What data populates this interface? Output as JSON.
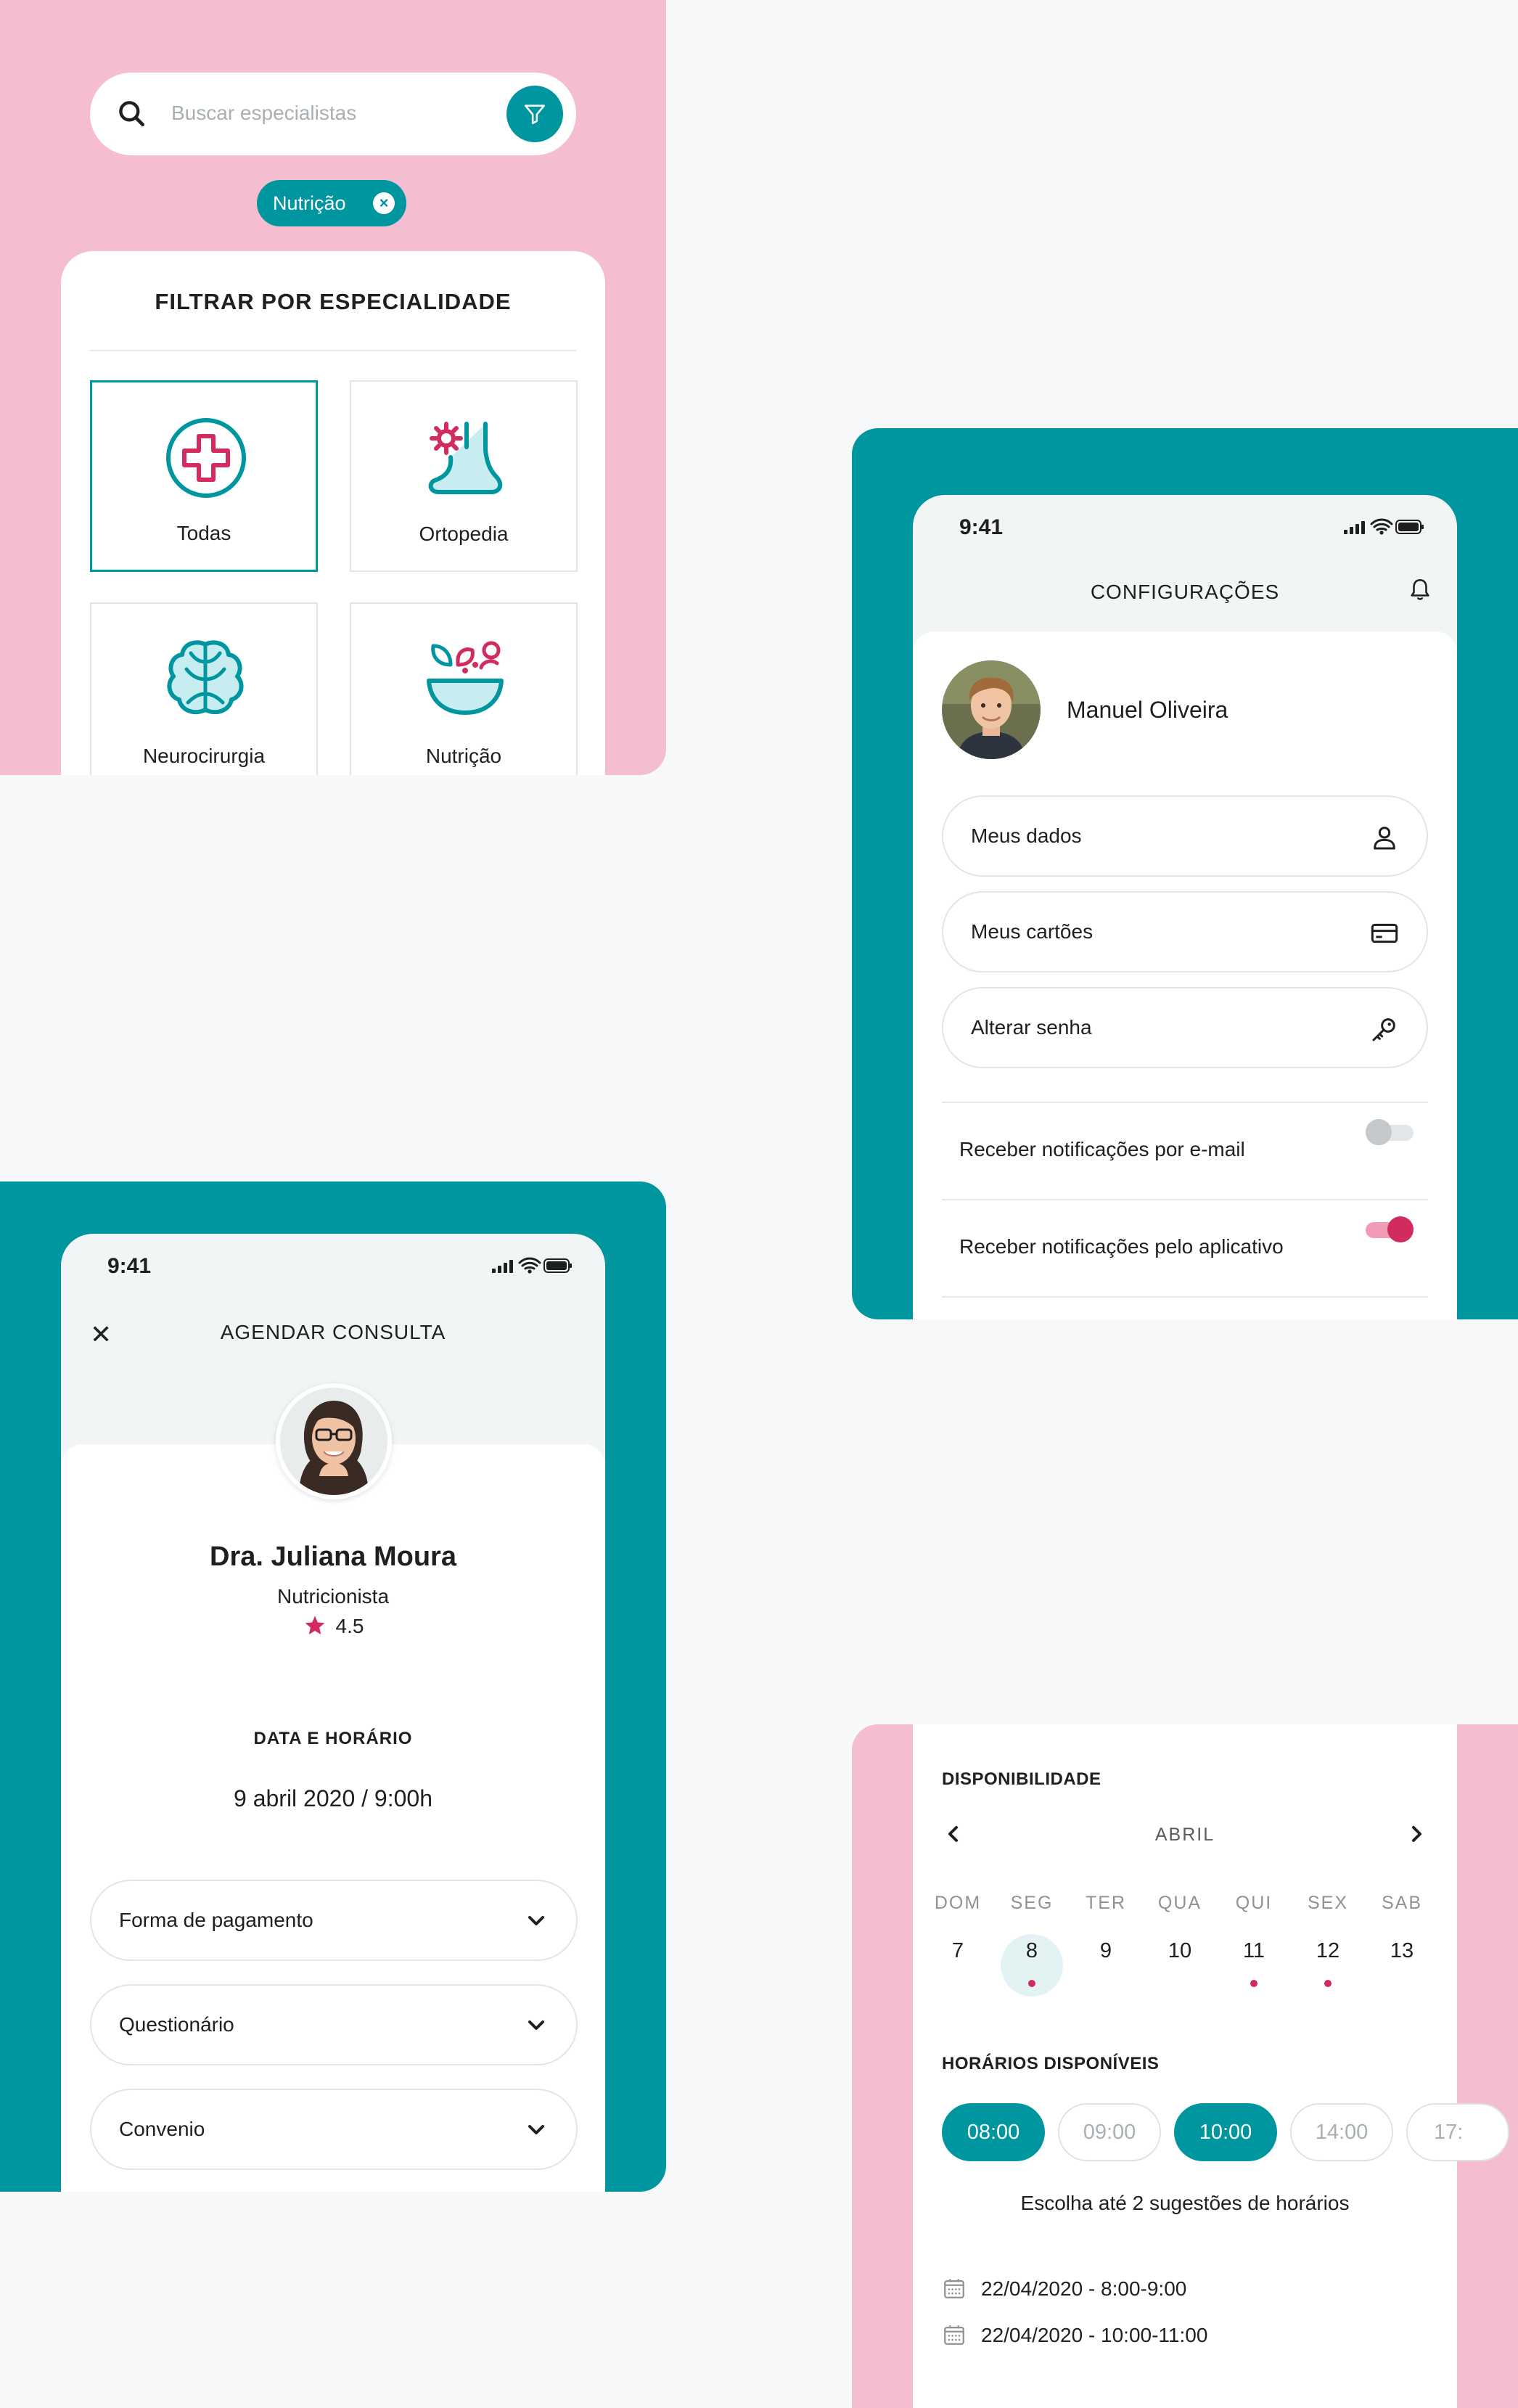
{
  "colors": {
    "teal": "#00969f",
    "pink": "#f4bdd0",
    "accent_red": "#d22b5e",
    "background": "#f7f8fa"
  },
  "search": {
    "placeholder": "Buscar especialistas",
    "icon": "search-icon",
    "filter_icon": "filter-icon",
    "active_chip": "Nutrição"
  },
  "filter": {
    "title": "FILTRAR POR ESPECIALIDADE",
    "items": [
      {
        "label": "Todas",
        "icon": "medical-cross-icon",
        "selected": true
      },
      {
        "label": "Ortopedia",
        "icon": "foot-icon",
        "selected": false
      },
      {
        "label": "Neurocirurgia",
        "icon": "brain-icon",
        "selected": false
      },
      {
        "label": "Nutrição",
        "icon": "salad-bowl-icon",
        "selected": false
      }
    ]
  },
  "settings": {
    "status_time": "9:41",
    "title": "CONFIGURAÇÕES",
    "user_name": "Manuel Oliveira",
    "menu": [
      {
        "label": "Meus dados",
        "icon": "user-icon"
      },
      {
        "label": "Meus cartões",
        "icon": "credit-card-icon"
      },
      {
        "label": "Alterar senha",
        "icon": "key-icon"
      }
    ],
    "toggles": [
      {
        "label": "Receber notificações por e-mail",
        "on": false
      },
      {
        "label": "Receber notificações pelo aplicativo",
        "on": true
      }
    ]
  },
  "appointment": {
    "status_time": "9:41",
    "title": "AGENDAR CONSULTA",
    "doctor_name": "Dra. Juliana Moura",
    "doctor_role": "Nutricionista",
    "rating": "4.5",
    "datetime_label": "DATA E HORÁRIO",
    "datetime": "9 abril 2020 / 9:00h",
    "dropdowns": [
      "Forma de pagamento",
      "Questionário",
      "Convenio"
    ]
  },
  "availability": {
    "title": "DISPONIBILIDADE",
    "month": "ABRIL",
    "weekdays": [
      "DOM",
      "SEG",
      "TER",
      "QUA",
      "QUI",
      "SEX",
      "SAB"
    ],
    "days": [
      "7",
      "8",
      "9",
      "10",
      "11",
      "12",
      "13"
    ],
    "selected_day": "8",
    "days_with_dot": [
      "8",
      "11",
      "12"
    ],
    "slots_title": "HORÁRIOS DISPONÍVEIS",
    "slots": [
      {
        "time": "08:00",
        "selected": true
      },
      {
        "time": "09:00",
        "selected": false
      },
      {
        "time": "10:00",
        "selected": true
      },
      {
        "time": "14:00",
        "selected": false
      },
      {
        "time": "17:",
        "selected": false
      }
    ],
    "hint": "Escolha até 2 sugestões de horários",
    "suggestions": [
      "22/04/2020 - 8:00-9:00",
      "22/04/2020 - 10:00-11:00"
    ]
  }
}
